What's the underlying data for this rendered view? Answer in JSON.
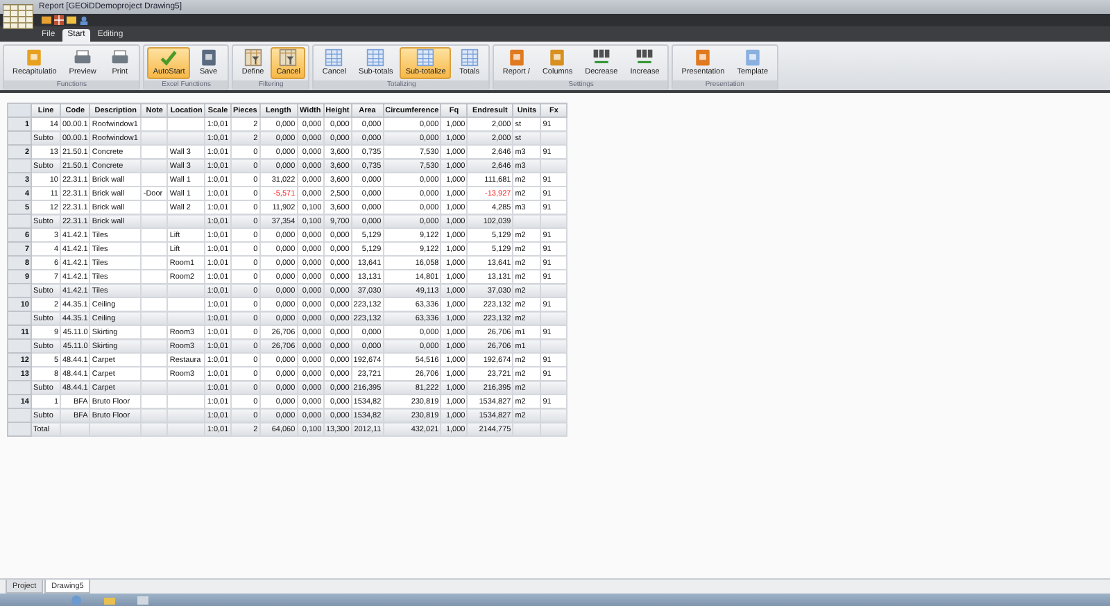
{
  "window": {
    "title": "Report [GEOiDDemoproject Drawing5]"
  },
  "ribbon_tabs": [
    {
      "label": "File",
      "selected": false
    },
    {
      "label": "Start",
      "selected": true
    },
    {
      "label": "Editing",
      "selected": false
    }
  ],
  "ribbon_groups": [
    {
      "label": "Functions",
      "buttons": [
        {
          "label": "Recapitulatio",
          "on": false
        },
        {
          "label": "Preview",
          "on": false
        },
        {
          "label": "Print",
          "on": false
        }
      ]
    },
    {
      "label": "Excel Functions",
      "buttons": [
        {
          "label": "AutoStart",
          "on": true
        },
        {
          "label": "Save",
          "on": false
        }
      ]
    },
    {
      "label": "Filtering",
      "buttons": [
        {
          "label": "Define",
          "on": false
        },
        {
          "label": "Cancel",
          "on": true
        }
      ]
    },
    {
      "label": "Totalizing",
      "buttons": [
        {
          "label": "Cancel",
          "on": false
        },
        {
          "label": "Sub-totals",
          "on": false
        },
        {
          "label": "Sub-totalize",
          "on": true
        },
        {
          "label": "Totals",
          "on": false
        }
      ]
    },
    {
      "label": "Settings",
      "buttons": [
        {
          "label": "Report /",
          "on": false
        },
        {
          "label": "Columns",
          "on": false
        },
        {
          "label": "Decrease",
          "on": false
        },
        {
          "label": "Increase",
          "on": false
        }
      ]
    },
    {
      "label": "Presentation",
      "buttons": [
        {
          "label": "Presentation",
          "on": false
        },
        {
          "label": "Template",
          "on": false
        }
      ]
    }
  ],
  "table": {
    "columns": [
      "Line",
      "Code",
      "Description",
      "Note",
      "Location",
      "Scale",
      "Pieces",
      "Length",
      "Width",
      "Height",
      "Area",
      "Circumference",
      "Fq",
      "Endresult",
      "Units",
      "Fx"
    ],
    "rows": [
      {
        "kind": "item",
        "number": "1",
        "cells": [
          "14",
          "00.00.1",
          "Roofwindow1",
          null,
          null,
          "1:0,01",
          "2",
          "0,000",
          "0,000",
          "0,000",
          "0,000",
          "0,000",
          "1,000",
          "2,000",
          "st",
          "91"
        ]
      },
      {
        "kind": "subtotal",
        "cells": [
          "Subto",
          "00.00.1",
          "Roofwindow1",
          null,
          null,
          "1:0,01",
          "2",
          "0,000",
          "0,000",
          "0,000",
          "0,000",
          "0,000",
          "1,000",
          "2,000",
          "st",
          null
        ]
      },
      {
        "kind": "item",
        "number": "2",
        "cells": [
          "13",
          "21.50.1",
          "Concrete",
          null,
          "Wall 3",
          "1:0,01",
          "0",
          "0,000",
          "0,000",
          "3,600",
          "0,735",
          "7,530",
          "1,000",
          "2,646",
          "m3",
          "91"
        ]
      },
      {
        "kind": "subtotal",
        "cells": [
          "Subto",
          "21.50.1",
          "Concrete",
          null,
          "Wall 3",
          "1:0,01",
          "0",
          "0,000",
          "0,000",
          "3,600",
          "0,735",
          "7,530",
          "1,000",
          "2,646",
          "m3",
          null
        ]
      },
      {
        "kind": "item",
        "number": "3",
        "cells": [
          "10",
          "22.31.1",
          "Brick wall",
          null,
          "Wall 1",
          "1:0,01",
          "0",
          "31,022",
          "0,000",
          "3,600",
          "0,000",
          "0,000",
          "1,000",
          "111,681",
          "m2",
          "91"
        ]
      },
      {
        "kind": "item",
        "number": "4",
        "cells": [
          "11",
          "22.31.1",
          "Brick wall",
          "-Door",
          "Wall 1",
          "1:0,01",
          "0",
          {
            "text": "-5,571",
            "negative": true
          },
          "0,000",
          "2,500",
          "0,000",
          "0,000",
          "1,000",
          {
            "text": "-13,927",
            "negative": true
          },
          "m2",
          "91"
        ]
      },
      {
        "kind": "item",
        "number": "5",
        "cells": [
          "12",
          "22.31.1",
          "Brick wall",
          null,
          "Wall 2",
          "1:0,01",
          "0",
          "11,902",
          "0,100",
          "3,600",
          "0,000",
          "0,000",
          "1,000",
          "4,285",
          "m3",
          "91"
        ]
      },
      {
        "kind": "subtotal",
        "cells": [
          "Subto",
          "22.31.1",
          "Brick wall",
          null,
          null,
          "1:0,01",
          "0",
          "37,354",
          "0,100",
          "9,700",
          "0,000",
          "0,000",
          "1,000",
          "102,039",
          null,
          null
        ]
      },
      {
        "kind": "item",
        "number": "6",
        "cells": [
          "3",
          "41.42.1",
          "Tiles",
          null,
          "Lift",
          "1:0,01",
          "0",
          "0,000",
          "0,000",
          "0,000",
          "5,129",
          "9,122",
          "1,000",
          "5,129",
          "m2",
          "91"
        ]
      },
      {
        "kind": "item",
        "number": "7",
        "cells": [
          "4",
          "41.42.1",
          "Tiles",
          null,
          "Lift",
          "1:0,01",
          "0",
          "0,000",
          "0,000",
          "0,000",
          "5,129",
          "9,122",
          "1,000",
          "5,129",
          "m2",
          "91"
        ]
      },
      {
        "kind": "item",
        "number": "8",
        "cells": [
          "6",
          "41.42.1",
          "Tiles",
          null,
          "Room1",
          "1:0,01",
          "0",
          "0,000",
          "0,000",
          "0,000",
          "13,641",
          "16,058",
          "1,000",
          "13,641",
          "m2",
          "91"
        ]
      },
      {
        "kind": "item",
        "number": "9",
        "cells": [
          "7",
          "41.42.1",
          "Tiles",
          null,
          "Room2",
          "1:0,01",
          "0",
          "0,000",
          "0,000",
          "0,000",
          "13,131",
          "14,801",
          "1,000",
          "13,131",
          "m2",
          "91"
        ]
      },
      {
        "kind": "subtotal",
        "cells": [
          "Subto",
          "41.42.1",
          "Tiles",
          null,
          null,
          "1:0,01",
          "0",
          "0,000",
          "0,000",
          "0,000",
          "37,030",
          "49,113",
          "1,000",
          "37,030",
          "m2",
          null
        ]
      },
      {
        "kind": "item",
        "number": "10",
        "cells": [
          "2",
          "44.35.1",
          "Ceiling",
          null,
          null,
          "1:0,01",
          "0",
          "0,000",
          "0,000",
          "0,000",
          "223,132",
          "63,336",
          "1,000",
          "223,132",
          "m2",
          "91"
        ]
      },
      {
        "kind": "subtotal",
        "cells": [
          "Subto",
          "44.35.1",
          "Ceiling",
          null,
          null,
          "1:0,01",
          "0",
          "0,000",
          "0,000",
          "0,000",
          "223,132",
          "63,336",
          "1,000",
          "223,132",
          "m2",
          null
        ]
      },
      {
        "kind": "item",
        "number": "11",
        "cells": [
          "9",
          "45.11.0",
          "Skirting",
          null,
          "Room3",
          "1:0,01",
          "0",
          "26,706",
          "0,000",
          "0,000",
          "0,000",
          "0,000",
          "1,000",
          "26,706",
          "m1",
          "91"
        ]
      },
      {
        "kind": "subtotal",
        "cells": [
          "Subto",
          "45.11.0",
          "Skirting",
          null,
          "Room3",
          "1:0,01",
          "0",
          "26,706",
          "0,000",
          "0,000",
          "0,000",
          "0,000",
          "1,000",
          "26,706",
          "m1",
          null
        ]
      },
      {
        "kind": "item",
        "number": "12",
        "cells": [
          "5",
          "48.44.1",
          "Carpet",
          null,
          "Restaura",
          "1:0,01",
          "0",
          "0,000",
          "0,000",
          "0,000",
          "192,674",
          "54,516",
          "1,000",
          "192,674",
          "m2",
          "91"
        ]
      },
      {
        "kind": "item",
        "number": "13",
        "cells": [
          "8",
          "48.44.1",
          "Carpet",
          null,
          "Room3",
          "1:0,01",
          "0",
          "0,000",
          "0,000",
          "0,000",
          "23,721",
          "26,706",
          "1,000",
          "23,721",
          "m2",
          "91"
        ]
      },
      {
        "kind": "subtotal",
        "cells": [
          "Subto",
          "48.44.1",
          "Carpet",
          null,
          null,
          "1:0,01",
          "0",
          "0,000",
          "0,000",
          "0,000",
          "216,395",
          "81,222",
          "1,000",
          "216,395",
          "m2",
          null
        ]
      },
      {
        "kind": "item",
        "number": "14",
        "cells": [
          "1",
          "BFA",
          "Bruto Floor",
          null,
          null,
          "1:0,01",
          "0",
          "0,000",
          "0,000",
          "0,000",
          "1534,82",
          "230,819",
          "1,000",
          "1534,827",
          "m2",
          "91"
        ]
      },
      {
        "kind": "subtotal",
        "cells": [
          "Subto",
          "BFA",
          "Bruto Floor",
          null,
          null,
          "1:0,01",
          "0",
          "0,000",
          "0,000",
          "0,000",
          "1534,82",
          "230,819",
          "1,000",
          "1534,827",
          "m2",
          null
        ]
      },
      {
        "kind": "total",
        "cells": [
          "Total",
          null,
          null,
          null,
          null,
          "1:0,01",
          "2",
          "64,060",
          "0,100",
          "13,300",
          "2012,11",
          "432,021",
          "1,000",
          "2144,775",
          null,
          null
        ]
      }
    ]
  },
  "sheet_tabs": [
    {
      "label": "Project",
      "selected": false
    },
    {
      "label": "Drawing5",
      "selected": true
    }
  ]
}
